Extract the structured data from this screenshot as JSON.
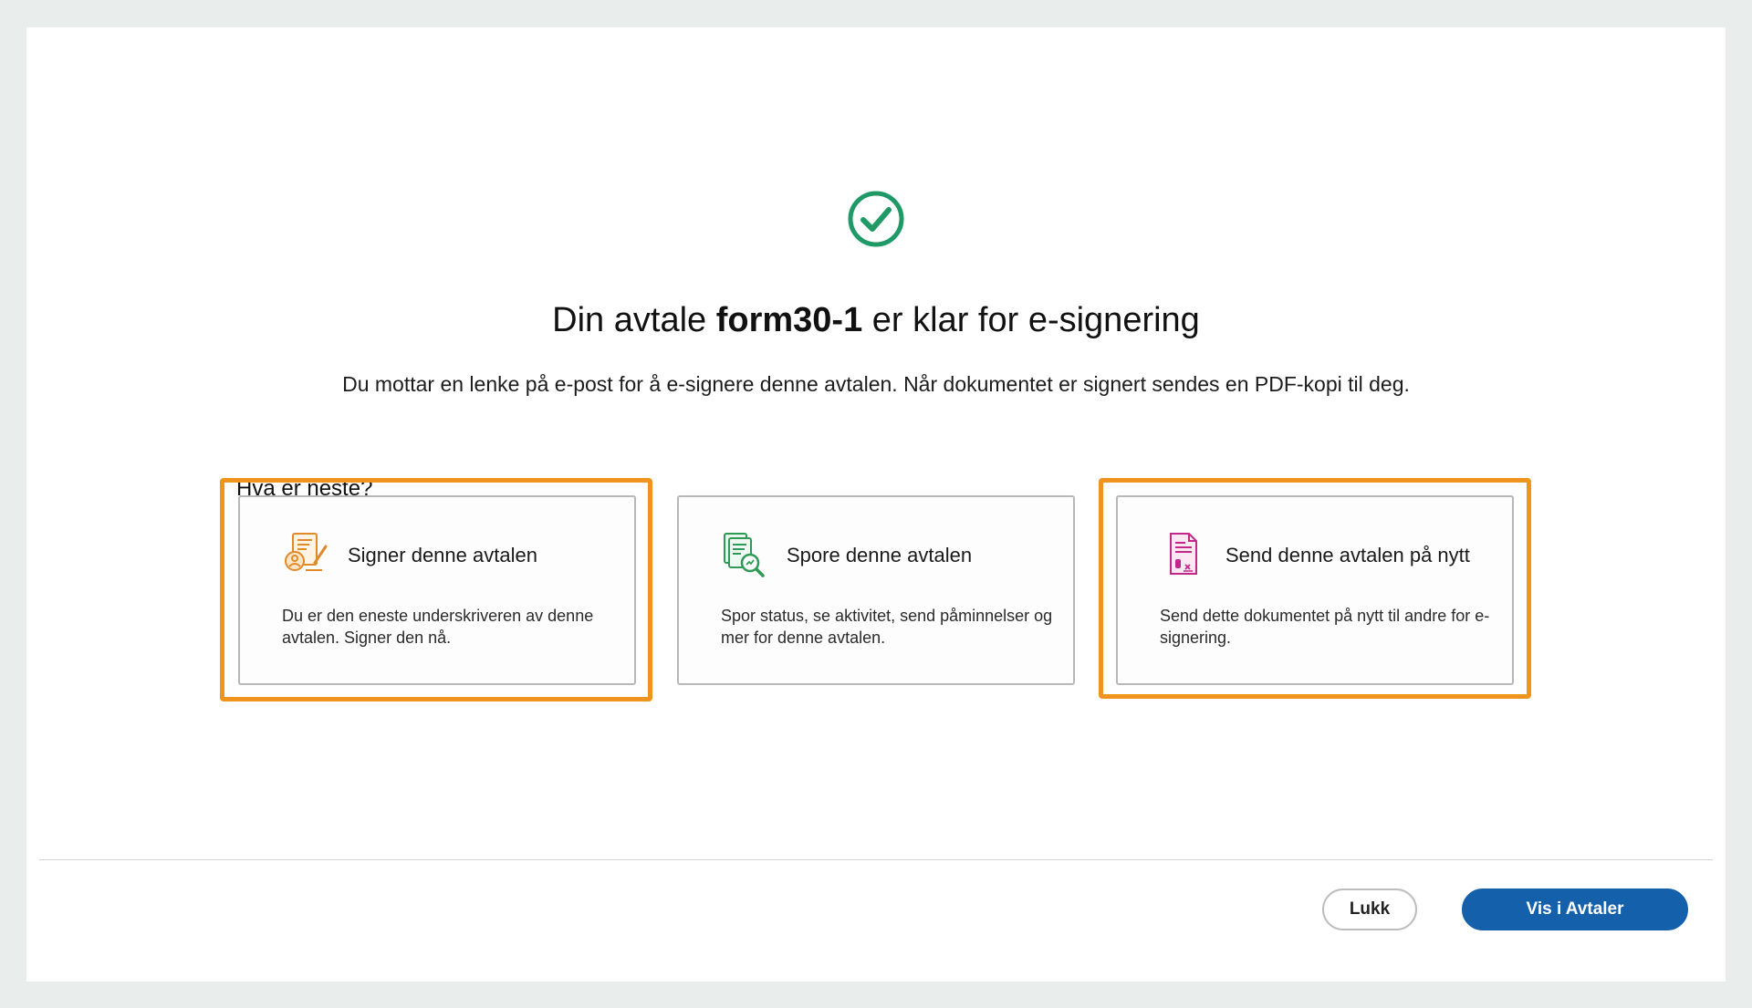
{
  "header": {
    "title_prefix": "Din avtale",
    "agreement_name": "form30-1",
    "title_suffix": "er klar for e-signering",
    "subtitle": "Du mottar en lenke på e-post for å e-signere denne avtalen. Når dokumentet er signert sendes en PDF-kopi til deg."
  },
  "next_section": {
    "label": "Hva er neste?",
    "cards": [
      {
        "title": "Signer denne avtalen",
        "description": "Du er den eneste underskriveren av denne avtalen. Signer den nå.",
        "icon": "sign-document-icon",
        "highlighted": true
      },
      {
        "title": "Spore denne avtalen",
        "description": "Spor status, se aktivitet, send påminnelser og mer for denne avtalen.",
        "icon": "track-document-icon",
        "highlighted": false
      },
      {
        "title": "Send denne avtalen på nytt",
        "description": "Send dette dokumentet på nytt til andre for e-signering.",
        "icon": "resend-document-icon",
        "highlighted": true
      }
    ]
  },
  "footer": {
    "close_label": "Lukk",
    "primary_label": "Vis i Avtaler"
  },
  "colors": {
    "success": "#1f9a66",
    "highlight": "#f0941e",
    "primary": "#1460aa",
    "sign_icon": "#e08a2a",
    "track_icon": "#2e9a55",
    "resend_icon": "#c2288a"
  }
}
